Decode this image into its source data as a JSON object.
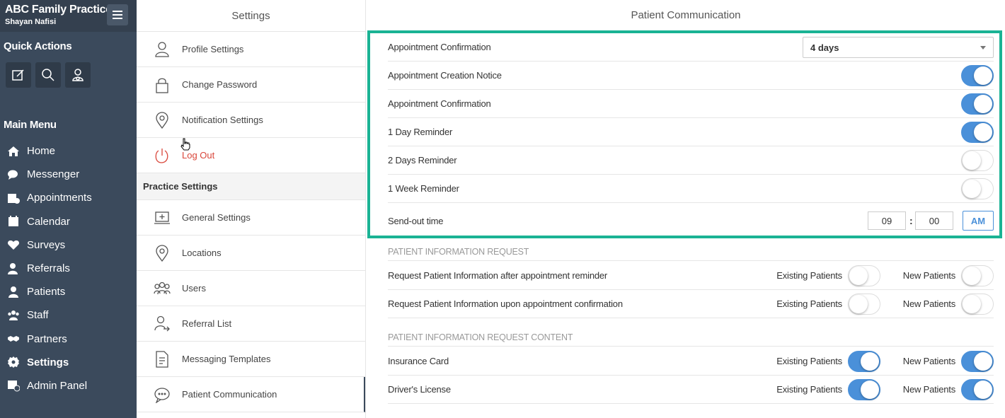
{
  "brand": {
    "title": "ABC Family Practice",
    "user": "Shayan Nafisi"
  },
  "quick_actions": {
    "heading": "Quick Actions",
    "icons": [
      "edit-icon",
      "search-icon",
      "user-icon"
    ]
  },
  "main_menu": {
    "heading": "Main Menu",
    "items": [
      {
        "label": "Home",
        "icon": "home-icon"
      },
      {
        "label": "Messenger",
        "icon": "chat-icon"
      },
      {
        "label": "Appointments",
        "icon": "calendar-check-icon"
      },
      {
        "label": "Calendar",
        "icon": "calendar-icon"
      },
      {
        "label": "Surveys",
        "icon": "heart-icon"
      },
      {
        "label": "Referrals",
        "icon": "user-plus-icon"
      },
      {
        "label": "Patients",
        "icon": "user-icon"
      },
      {
        "label": "Staff",
        "icon": "users-icon"
      },
      {
        "label": "Partners",
        "icon": "handshake-icon"
      },
      {
        "label": "Settings",
        "icon": "gear-icon",
        "active": true
      },
      {
        "label": "Admin Panel",
        "icon": "admin-icon"
      }
    ]
  },
  "settings": {
    "title": "Settings",
    "items": [
      {
        "label": "Profile Settings",
        "icon": "user-outline-icon"
      },
      {
        "label": "Change Password",
        "icon": "lock-icon"
      },
      {
        "label": "Notification Settings",
        "icon": "map-pin-icon"
      },
      {
        "label": "Log Out",
        "icon": "power-icon"
      }
    ],
    "practice_heading": "Practice Settings",
    "practice_items": [
      {
        "label": "General Settings",
        "icon": "monitor-plus-icon"
      },
      {
        "label": "Locations",
        "icon": "map-pin-icon"
      },
      {
        "label": "Users",
        "icon": "users-outline-icon"
      },
      {
        "label": "Referral List",
        "icon": "user-arrow-icon"
      },
      {
        "label": "Messaging Templates",
        "icon": "document-icon"
      },
      {
        "label": "Patient Communication",
        "icon": "chat-bubble-icon"
      }
    ]
  },
  "main": {
    "title": "Patient Communication",
    "confirmation_label": "Appointment Confirmation",
    "confirmation_value": "4 days",
    "toggles": [
      {
        "label": "Appointment Creation Notice",
        "on": true
      },
      {
        "label": "Appointment Confirmation",
        "on": true
      },
      {
        "label": "1 Day Reminder",
        "on": true
      },
      {
        "label": "2 Days Reminder",
        "on": false
      },
      {
        "label": "1 Week Reminder",
        "on": false
      }
    ],
    "sendout": {
      "label": "Send-out time",
      "hour": "09",
      "sep": ":",
      "minute": "00",
      "ampm": "AM"
    },
    "info_request": {
      "heading": "PATIENT INFORMATION REQUEST",
      "rows": [
        {
          "label": "Request Patient Information after appointment reminder",
          "existing": false,
          "new": false
        },
        {
          "label": "Request Patient Information upon appointment confirmation",
          "existing": false,
          "new": false
        }
      ]
    },
    "info_content": {
      "heading": "PATIENT INFORMATION REQUEST CONTENT",
      "rows": [
        {
          "label": "Insurance Card",
          "existing": true,
          "new": true
        },
        {
          "label": "Driver's License",
          "existing": true,
          "new": true
        }
      ]
    },
    "existing_label": "Existing Patients",
    "new_label": "New Patients"
  },
  "colors": {
    "sidebar": "#3b4a5c",
    "accent": "#4a90d9",
    "highlight": "#1ab394",
    "logout": "#d9463a"
  }
}
